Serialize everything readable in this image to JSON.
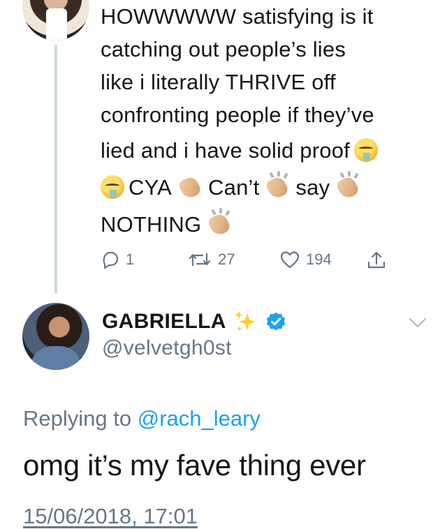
{
  "parent_tweet": {
    "text_lines": [
      "HOWWWWW satisfying is it",
      "catching out people’s lies",
      "like i literally THRIVE off",
      "confronting people if they’ve",
      "lied and i have solid proof"
    ],
    "line6": {
      "a": "CYA",
      "b": "Can’t",
      "c": "say"
    },
    "line7": "NOTHING",
    "emojis": [
      "relieved-face-icon",
      "clapping-hands-icon"
    ],
    "actions": {
      "reply_count": "1",
      "retweet_count": "27",
      "like_count": "194"
    }
  },
  "reply_tweet": {
    "display_name": "GABRIELLA",
    "handle": "@velvetgh0st",
    "replying_prefix": "Replying to",
    "replying_to": "@rach_leary",
    "text": "omg it’s my fave thing ever",
    "timestamp": "15/06/2018, 17:01"
  },
  "colors": {
    "text": "#14171a",
    "secondary": "#657786",
    "link": "#1da1f2",
    "thread_line": "#ccd6dd"
  }
}
